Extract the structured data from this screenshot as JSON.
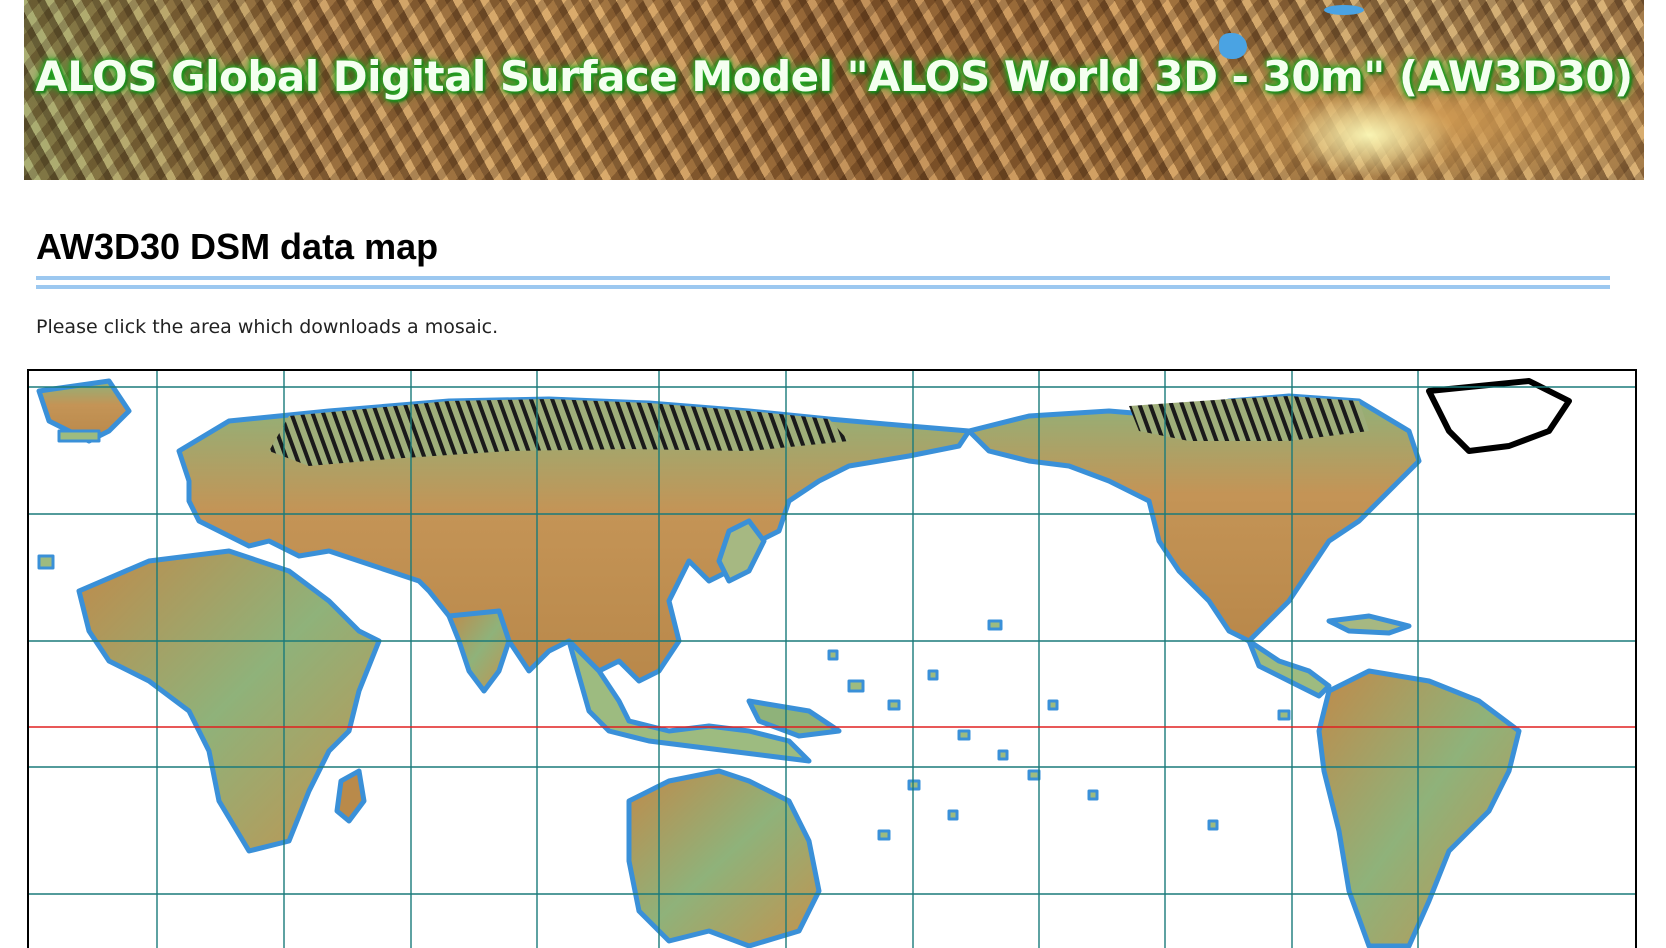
{
  "banner": {
    "title": "ALOS Global Digital Surface Model \"ALOS World 3D - 30m\" (AW3D30)"
  },
  "page": {
    "title": "AW3D30 DSM data map",
    "instructions": "Please click the area which downloads a mosaic."
  },
  "map": {
    "grid_color": "#1a7a7a",
    "equator_color": "#e02020",
    "ocean_color": "#ffffff",
    "coast_color": "#3a90d8",
    "land_low_color": "#7fb078",
    "land_high_color": "#b07a3c",
    "tile_columns": 12,
    "tile_rows_visible": 5,
    "equator_row_fraction": 0.648
  }
}
